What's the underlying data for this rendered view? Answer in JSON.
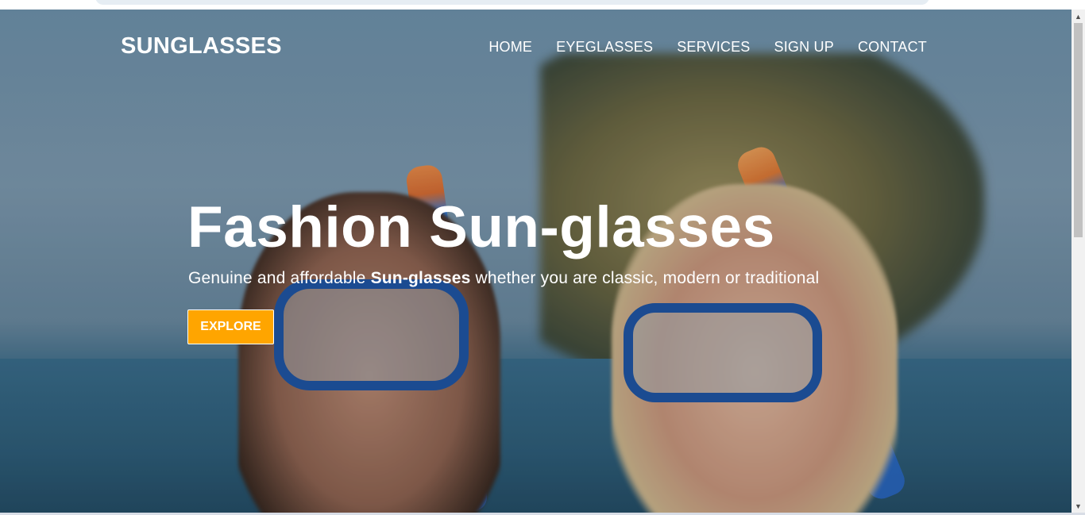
{
  "brand": {
    "name": "SUNGLASSES"
  },
  "nav": {
    "items": [
      {
        "label": "HOME"
      },
      {
        "label": "EYEGLASSES"
      },
      {
        "label": "SERVICES"
      },
      {
        "label": "SIGN UP"
      },
      {
        "label": "CONTACT"
      }
    ]
  },
  "hero": {
    "headline": "Fashion Sun-glasses",
    "subline_before": "Genuine and affordable ",
    "subline_bold": "Sun-glasses",
    "subline_after": " whether you are classic, modern or traditional",
    "cta_label": "EXPLORE"
  },
  "scrollbar": {
    "up_icon": "▲",
    "down_icon": "▼"
  },
  "colors": {
    "accent": "#ffa500",
    "text": "#ffffff"
  }
}
